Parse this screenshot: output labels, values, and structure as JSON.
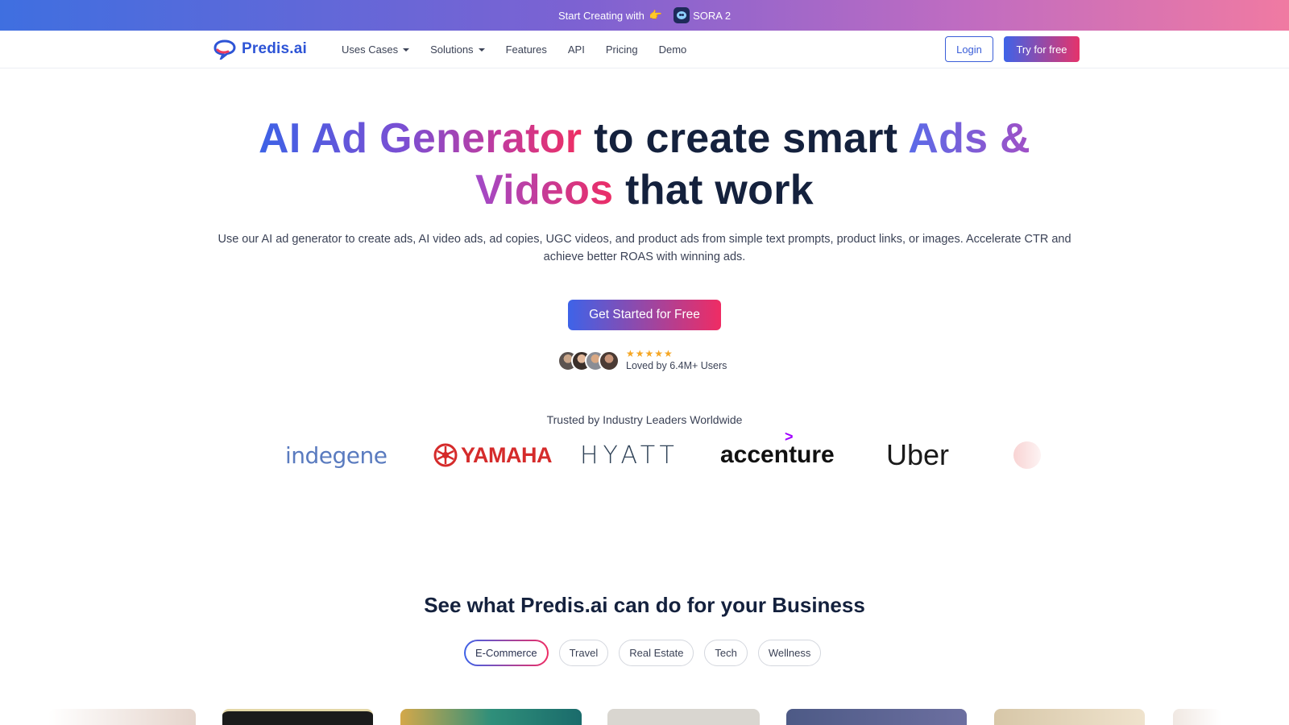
{
  "announcement": {
    "text": "Start Creating with",
    "pointer": "👉",
    "badge_label": "SORA 2"
  },
  "nav": {
    "logo_text": "Predis.ai",
    "menu": [
      {
        "label": "Uses Cases",
        "has_dropdown": true
      },
      {
        "label": "Solutions",
        "has_dropdown": true
      },
      {
        "label": "Features",
        "has_dropdown": false
      },
      {
        "label": "API",
        "has_dropdown": false
      },
      {
        "label": "Pricing",
        "has_dropdown": false
      },
      {
        "label": "Demo",
        "has_dropdown": false
      }
    ],
    "login_label": "Login",
    "try_label": "Try for free"
  },
  "hero": {
    "title_part1": "AI Ad Generator",
    "title_part2": " to create smart ",
    "title_part3": "Ads &",
    "title_part4": "Videos",
    "title_part5": " that work",
    "subtitle": "Use our AI ad generator to create ads, AI video ads, ad copies, UGC videos, and product ads from simple text prompts, product links, or images. Accelerate CTR and achieve better ROAS with winning ads.",
    "cta_label": "Get Started for Free",
    "stars": "★★★★★",
    "loved_text": "Loved by 6.4M+ Users"
  },
  "trusted": {
    "heading": "Trusted by Industry Leaders Worldwide",
    "brands": [
      "indegene",
      "YAMAHA",
      "HYATT",
      "accenture",
      "Uber"
    ]
  },
  "business": {
    "heading": "See what Predis.ai can do for your Business",
    "tabs": [
      "E-Commerce",
      "Travel",
      "Real Estate",
      "Tech",
      "Wellness"
    ],
    "active_tab": "E-Commerce"
  },
  "colors": {
    "primary": "#3e63e8",
    "accent": "#ef2c64",
    "heading": "#14213d"
  }
}
